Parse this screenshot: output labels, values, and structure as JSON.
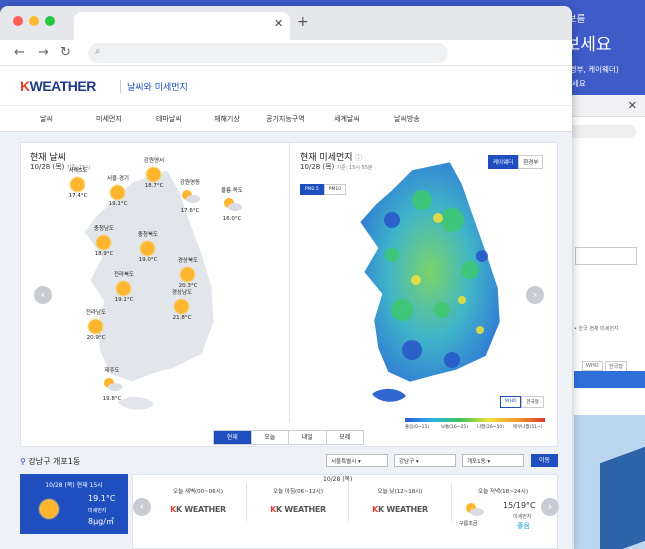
{
  "promo": {
    "line1": "날씨와 미세먼지 정보를",
    "line2_highlight": "동별",
    "line2_rest": "로 확인해보세요",
    "line3": "모든 날씨와 미세먼지를 (기상청, 환경부, 케이웨더)",
    "line4": "비교하고 정확도를 확인하세요"
  },
  "site": {
    "logo_k": "K",
    "logo_rest": "WEATHER",
    "subtitle": "날씨와 미세먼지",
    "menu": [
      "날씨",
      "미세먼지",
      "테마날씨",
      "재해기상",
      "공기지능구역",
      "세계날씨",
      "날씨방송"
    ]
  },
  "weather_panel": {
    "title": "현재 날씨",
    "date": "10/28 (목)",
    "time_note": "기준: 15시",
    "regions": [
      {
        "name": "서해5도",
        "temp": "17.4°C",
        "icon": "sun"
      },
      {
        "name": "서울·경기",
        "temp": "19.1°C",
        "icon": "sun"
      },
      {
        "name": "강원영서",
        "temp": "18.7°C",
        "icon": "sun"
      },
      {
        "name": "강원영동",
        "temp": "17.6°C",
        "icon": "cloud-sun"
      },
      {
        "name": "울릉·독도",
        "temp": "16.0°C",
        "icon": "cloud-sun"
      },
      {
        "name": "충청남도",
        "temp": "18.9°C",
        "icon": "sun"
      },
      {
        "name": "충청북도",
        "temp": "19.0°C",
        "icon": "sun"
      },
      {
        "name": "경상북도",
        "temp": "20.3°C",
        "icon": "sun"
      },
      {
        "name": "전라북도",
        "temp": "19.1°C",
        "icon": "sun"
      },
      {
        "name": "경상남도",
        "temp": "21.8°C",
        "icon": "sun"
      },
      {
        "name": "전라남도",
        "temp": "20.9°C",
        "icon": "sun"
      },
      {
        "name": "제주도",
        "temp": "19.8°C",
        "icon": "cloud-sun"
      }
    ]
  },
  "dust_panel": {
    "title": "현재 미세먼지",
    "date": "10/28 (목)",
    "time_note": "기준: 15시 55분",
    "source_tabs": [
      "케이웨더",
      "환경부"
    ],
    "pm_tabs": [
      "PM2.5",
      "PM10"
    ],
    "standard_tabs": [
      "WHO",
      "한국형"
    ],
    "legend": [
      "좋음(0~15)",
      "보통(16~25)",
      "나쁨(26~50)",
      "매우나쁨(51~)"
    ]
  },
  "time_tabs": [
    "현재",
    "오늘",
    "내일",
    "모레"
  ],
  "location": {
    "label": "강남구 개포1동",
    "selects": [
      "서울특별시",
      "강남구",
      "개포1동"
    ],
    "go": "이동"
  },
  "current_card": {
    "header": "10/28 (목) 현재 15시",
    "temp": "19.1°C",
    "dust_label": "미세먼지",
    "dust_value": "8μg/㎥"
  },
  "forecast": {
    "date": "10/28 (목)",
    "slots": [
      "오늘 새벽(00~06시)",
      "오늘 아침(06~12시)",
      "오늘 낮(12~18시)",
      "오늘 저녁(18~24시)"
    ],
    "brand": "K WEATHER",
    "evening_sky": "구름조금",
    "evening_temp": "15/19°C",
    "evening_dust_label": "미세먼지",
    "evening_dust": "좋음"
  },
  "back_browser": {
    "row1": "• 한국 현재 미세먼지",
    "who": "WHO",
    "korean": "한국형"
  }
}
